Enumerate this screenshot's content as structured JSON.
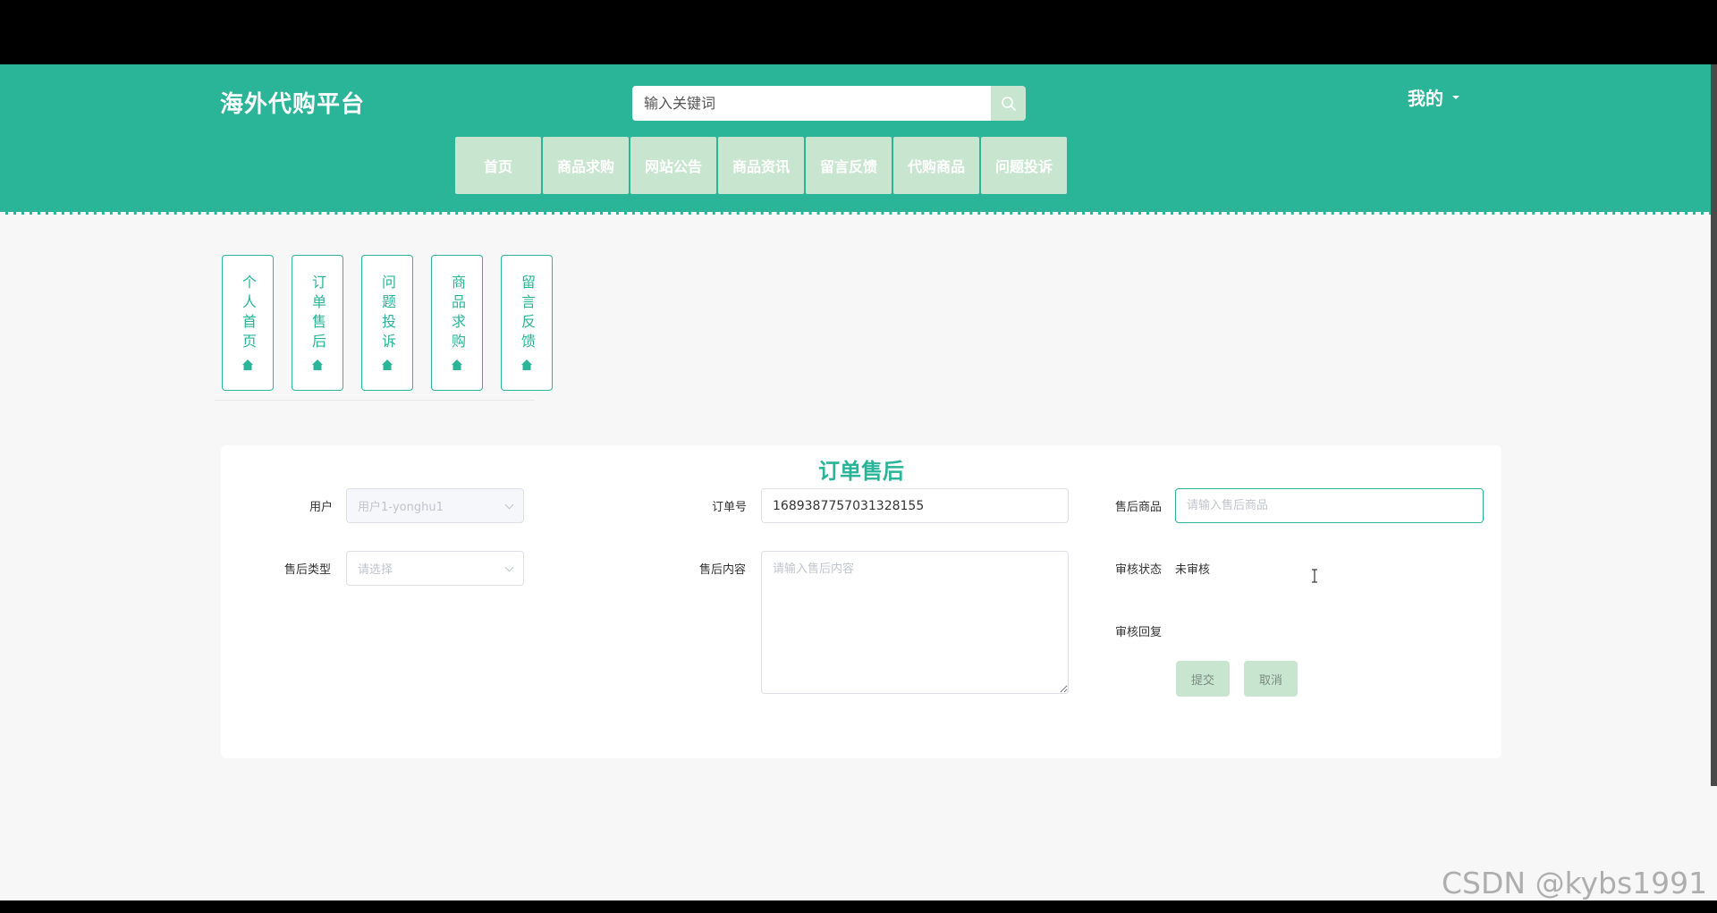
{
  "header": {
    "logo": "海外代购平台",
    "search_placeholder": "输入关键词",
    "user_menu": "我的"
  },
  "nav": [
    "首页",
    "商品求购",
    "网站公告",
    "商品资讯",
    "留言反馈",
    "代购商品",
    "问题投诉"
  ],
  "side_tabs": [
    "个人首页",
    "订单售后",
    "问题投诉",
    "商品求购",
    "留言反馈"
  ],
  "form": {
    "title": "订单售后",
    "user_label": "用户",
    "user_value": "用户1-yonghu1",
    "order_label": "订单号",
    "order_value": "1689387757031328155",
    "product_label": "售后商品",
    "product_placeholder": "请输入售后商品",
    "type_label": "售后类型",
    "type_placeholder": "请选择",
    "content_label": "售后内容",
    "content_placeholder": "请输入售后内容",
    "status_label": "审核状态",
    "status_value": "未审核",
    "reply_label": "审核回复",
    "submit": "提交",
    "cancel": "取消"
  },
  "watermark": "CSDN @kybs1991",
  "colors": {
    "primary": "#2ab498",
    "nav_bg": "#c8e6cf",
    "page_bg": "#f7f7f7"
  }
}
